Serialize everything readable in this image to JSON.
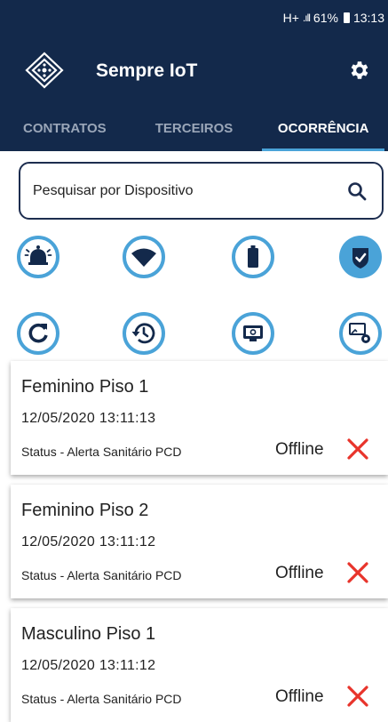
{
  "status_bar": {
    "network": "H+",
    "signal": ".ıll",
    "battery": "61%",
    "time": "13:13"
  },
  "app": {
    "title": "Sempre IoT"
  },
  "tabs": [
    {
      "label": "CONTRATOS",
      "active": false
    },
    {
      "label": "TERCEIROS",
      "active": false
    },
    {
      "label": "OCORRÊNCIA",
      "active": true
    }
  ],
  "search": {
    "placeholder": "Pesquisar por Dispositivo",
    "value": ""
  },
  "filters": {
    "row1": [
      "alarm-bell-icon",
      "wifi-icon",
      "battery-icon",
      "shield-check-icon"
    ],
    "row2": [
      "refresh-icon",
      "history-icon",
      "monitor-settings-icon",
      "screen-cast-settings-icon"
    ]
  },
  "occurrences": [
    {
      "name": "Feminino Piso 1",
      "datetime": "12/05/2020  13:11:13",
      "status": "Status - Alerta Sanitário PCD",
      "state": "Offline"
    },
    {
      "name": "Feminino Piso 2",
      "datetime": "12/05/2020  13:11:12",
      "status": "Status - Alerta Sanitário PCD",
      "state": "Offline"
    },
    {
      "name": "Masculino Piso 1",
      "datetime": "12/05/2020  13:11:12",
      "status": "Status - Alerta Sanitário PCD",
      "state": "Offline"
    }
  ],
  "colors": {
    "header": "#13294b",
    "accent": "#4aa3d8",
    "offline_x": "#e8342b"
  }
}
